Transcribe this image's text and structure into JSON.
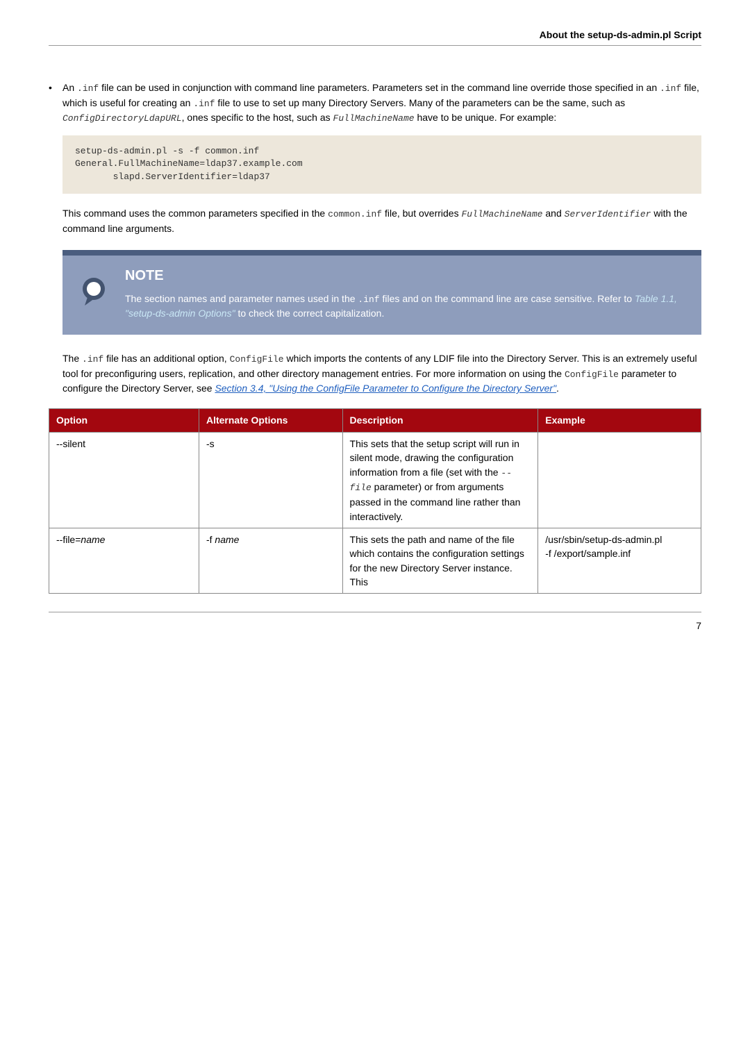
{
  "header": {
    "title": "About the setup-ds-admin.pl Script"
  },
  "bullet": {
    "text_parts": {
      "t1": "An ",
      "c1": ".inf",
      "t2": " file can be used in conjunction with command line parameters. Parameters set in the command line override those specified in an ",
      "c2": ".inf",
      "t3": " file, which is useful for creating an ",
      "c3": ".inf",
      "t4": " file to use to set up many Directory Servers. Many of the parameters can be the same, such as ",
      "p1": "ConfigDirectoryLdapURL",
      "t5": ", ones specific to the host, such as ",
      "p2": "FullMachineName",
      "t6": " have to be unique. For example:"
    }
  },
  "codebox1": "setup-ds-admin.pl -s -f common.inf\nGeneral.FullMachineName=ldap37.example.com\n       slapd.ServerIdentifier=ldap37",
  "para1": {
    "t1": "This command uses the common parameters specified in the ",
    "c1": "common.inf",
    "t2": " file, but overrides ",
    "p1": "FullMachineName",
    "t3": " and ",
    "p2": "ServerIdentifier",
    "t4": " with the command line arguments."
  },
  "note": {
    "title": "NOTE",
    "t1": "The section names and parameter names used in the ",
    "c1": ".inf",
    "t2": " files and on the command line are case sensitive. Refer to ",
    "link": "Table 1.1, \"setup-ds-admin Options\"",
    "t3": " to check the correct capitalization."
  },
  "para2": {
    "t1": "The ",
    "c1": ".inf",
    "t2": " file has an additional option, ",
    "c2": "ConfigFile",
    "t3": " which imports the contents of any LDIF file into the Directory Server. This is an extremely useful tool for preconfiguring users, replication, and other directory management entries. For more information on using the ",
    "c3": "ConfigFile",
    "t4": " parameter to configure the Directory Server, see ",
    "link": "Section 3.4, \"Using the ConfigFile Parameter to Configure the Directory Server\"",
    "t5": "."
  },
  "table": {
    "headers": {
      "h1": "Option",
      "h2": "Alternate Options",
      "h3": "Description",
      "h4": "Example"
    },
    "rows": [
      {
        "option": "--silent",
        "alt": "-s",
        "desc": {
          "t1": "This sets that the setup script will run in silent mode, drawing the configuration information from a file (set with the ",
          "p1": "--file",
          "t2": " parameter) or from arguments passed in the command line rather than interactively."
        },
        "example": ""
      },
      {
        "option_pre": "--file=",
        "option_em": "name",
        "alt_pre": "-f ",
        "alt_em": "name",
        "desc_plain": "This sets the path and name of the file which contains the configuration settings for the new Directory Server instance. This",
        "example_l1": "/usr/sbin/setup-ds-admin.pl",
        "example_l2": "-f /export/sample.inf"
      }
    ]
  },
  "footer": {
    "page_num": "7"
  }
}
